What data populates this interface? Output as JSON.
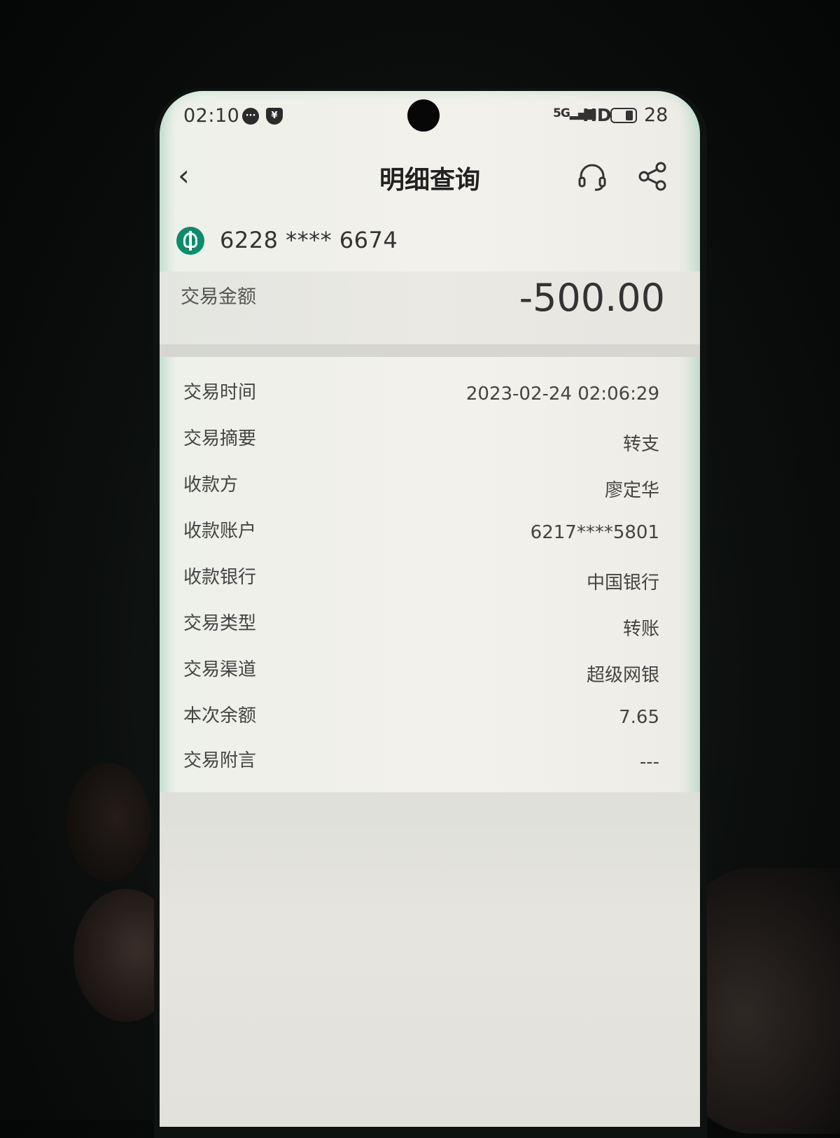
{
  "status_bar": {
    "time": "02:10",
    "network": "5G",
    "hd": "HD",
    "battery": "28"
  },
  "header": {
    "title": "明细查询"
  },
  "account": {
    "number": "6228 **** 6674"
  },
  "amount": {
    "label": "交易金额",
    "value": "-500.00"
  },
  "details": [
    {
      "label": "交易时间",
      "value": "2023-02-24 02:06:29"
    },
    {
      "label": "交易摘要",
      "value": "转支"
    },
    {
      "label": "收款方",
      "value": "廖定华"
    },
    {
      "label": "收款账户",
      "value": "6217****5801"
    },
    {
      "label": "收款银行",
      "value": "中国银行"
    },
    {
      "label": "交易类型",
      "value": "转账"
    },
    {
      "label": "交易渠道",
      "value": "超级网银"
    },
    {
      "label": "本次余额",
      "value": "7.65"
    },
    {
      "label": "交易附言",
      "value": "---"
    }
  ],
  "colors": {
    "bank_green": "#0b8c6a",
    "text_dark": "#333333"
  }
}
